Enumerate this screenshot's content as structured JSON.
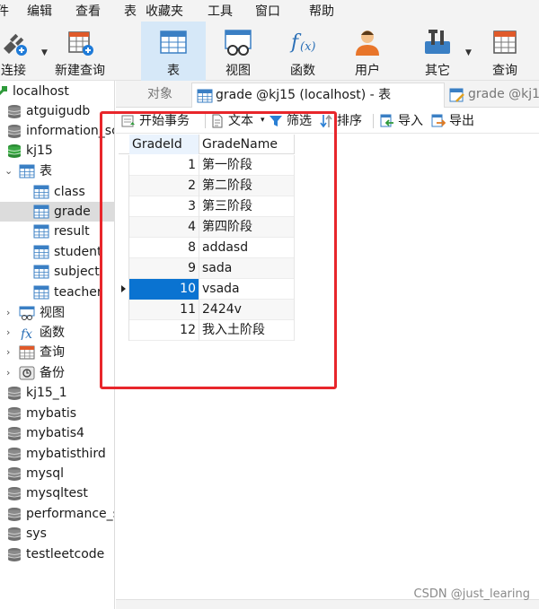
{
  "menu": [
    "件",
    "编辑",
    "查看",
    "表",
    "收藏夹",
    "工具",
    "窗口",
    "帮助"
  ],
  "toolbar": {
    "connect": "连接",
    "new_query": "新建查询",
    "table": "表",
    "view": "视图",
    "function": "函数",
    "user": "用户",
    "other": "其它",
    "query": "查询"
  },
  "sidebar": {
    "root": "localhost",
    "databases_top": [
      "atguigudb",
      "information_sc",
      "kj15"
    ],
    "tables_group": "表",
    "tables": [
      "class",
      "grade",
      "result",
      "student",
      "subject",
      "teacher"
    ],
    "groups": [
      "视图",
      "函数",
      "查询",
      "备份"
    ],
    "databases_bottom": [
      "kj15_1",
      "mybatis",
      "mybatis4",
      "mybatisthird",
      "mysql",
      "mysqltest",
      "performance_s",
      "sys",
      "testleetcode"
    ]
  },
  "tabs": {
    "objects": "对象",
    "grade": "grade @kj15 (localhost) - 表",
    "other": "grade @kj1"
  },
  "table_toolbar": {
    "begin_tx": "开始事务",
    "text": "文本",
    "filter": "筛选",
    "sort": "排序",
    "import": "导入",
    "export": "导出"
  },
  "grid": {
    "columns": [
      "GradeId",
      "GradeName"
    ],
    "rows": [
      {
        "id": "1",
        "name": "第一阶段"
      },
      {
        "id": "2",
        "name": "第二阶段"
      },
      {
        "id": "3",
        "name": "第三阶段"
      },
      {
        "id": "4",
        "name": "第四阶段"
      },
      {
        "id": "8",
        "name": "addasd"
      },
      {
        "id": "9",
        "name": "sada"
      },
      {
        "id": "10",
        "name": "vsada"
      },
      {
        "id": "11",
        "name": "2424v"
      },
      {
        "id": "12",
        "name": "我入土阶段"
      }
    ],
    "selected_index": 6
  },
  "watermark": "CSDN @just_learing",
  "colors": {
    "selection": "#0a73d1",
    "highlight": "#e8262b",
    "active_tool": "#d6e8f8"
  }
}
